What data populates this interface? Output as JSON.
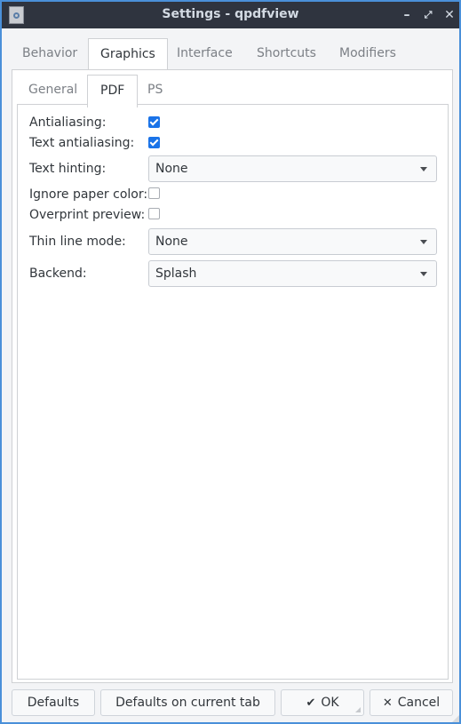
{
  "window": {
    "title": "Settings - qpdfview",
    "minimize_glyph": "–",
    "maximize_glyph": "⤢",
    "close_glyph": "✕"
  },
  "tabs": [
    {
      "label": "Behavior",
      "active": false
    },
    {
      "label": "Graphics",
      "active": true
    },
    {
      "label": "Interface",
      "active": false
    },
    {
      "label": "Shortcuts",
      "active": false
    },
    {
      "label": "Modifiers",
      "active": false
    }
  ],
  "subtabs": [
    {
      "label": "General",
      "active": false
    },
    {
      "label": "PDF",
      "active": true
    },
    {
      "label": "PS",
      "active": false
    }
  ],
  "pdf_settings": {
    "antialiasing": {
      "label": "Antialiasing:",
      "checked": true
    },
    "text_antialiasing": {
      "label": "Text antialiasing:",
      "checked": true
    },
    "text_hinting": {
      "label": "Text hinting:",
      "value": "None"
    },
    "ignore_paper_color": {
      "label": "Ignore paper color:",
      "checked": false
    },
    "overprint_preview": {
      "label": "Overprint preview:",
      "checked": false
    },
    "thin_line_mode": {
      "label": "Thin line mode:",
      "value": "None"
    },
    "backend": {
      "label": "Backend:",
      "value": "Splash"
    }
  },
  "buttons": {
    "defaults": "Defaults",
    "defaults_on_current_tab": "Defaults on current tab",
    "ok": "OK",
    "ok_glyph": "✔",
    "cancel": "Cancel",
    "cancel_glyph": "✕"
  }
}
